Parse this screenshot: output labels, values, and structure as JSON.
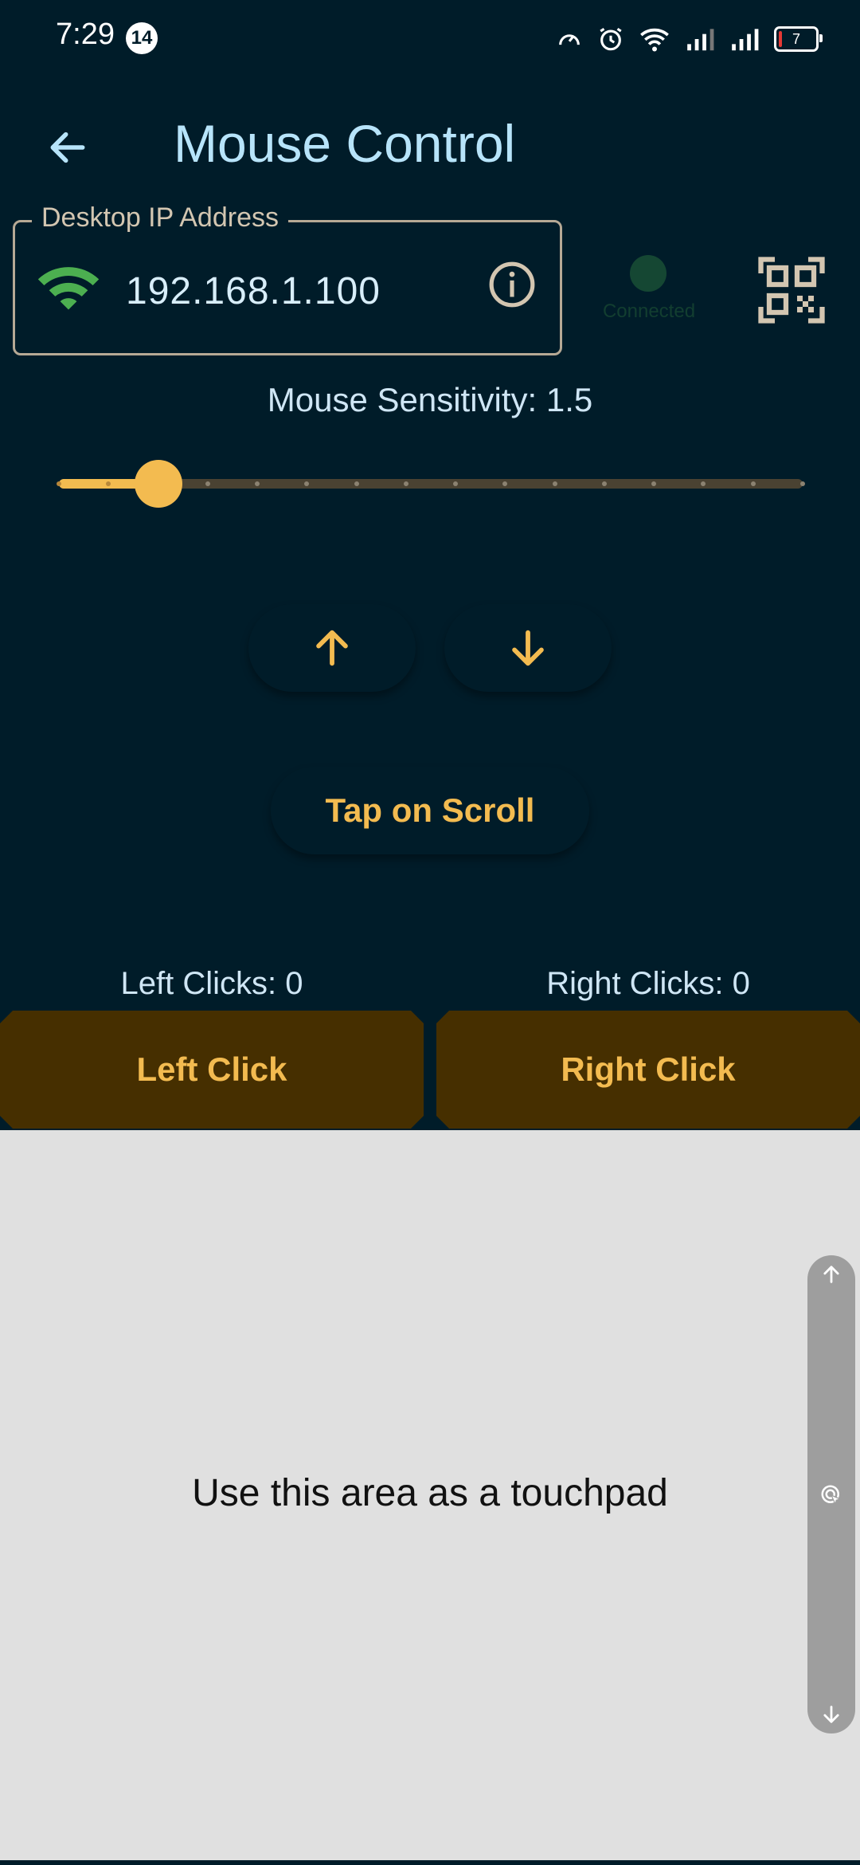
{
  "status_bar": {
    "time": "7:29",
    "notification_count": "14",
    "battery_level": "7",
    "icons": [
      "speedometer-icon",
      "alarm-icon",
      "wifi-icon",
      "signal-icon",
      "signal-icon",
      "battery-icon"
    ]
  },
  "app_bar": {
    "title": "Mouse Control",
    "back_icon": "arrow-left-icon"
  },
  "ip_field": {
    "label": "Desktop IP Address",
    "value": "192.168.1.100",
    "leading_icon": "wifi-icon",
    "trailing_icon": "info-icon"
  },
  "connection": {
    "status_text": "Connected",
    "indicator_color": "#154733"
  },
  "qr_button": {
    "icon": "qr-code-icon"
  },
  "sensitivity": {
    "label": "Mouse Sensitivity: 1.5",
    "value": 1.5,
    "min": 0.5,
    "max": 8.0,
    "divisions": 15
  },
  "scroll_controls": {
    "up_icon": "arrow-up-icon",
    "down_icon": "arrow-down-icon",
    "tap_on_scroll_label": "Tap on Scroll"
  },
  "clicks": {
    "left_count_label": "Left Clicks: 0",
    "right_count_label": "Right Clicks: 0",
    "left_button_label": "Left Click",
    "right_button_label": "Right Click"
  },
  "touchpad": {
    "hint": "Use this area as a touchpad",
    "scrollbar_icons": [
      "arrow-up-icon",
      "touch-icon",
      "arrow-down-icon"
    ]
  },
  "colors": {
    "background": "#001c29",
    "accent": "#f3bb50",
    "button_bg": "#462f00",
    "touchpad_bg": "#e0e0e0",
    "wifi_green": "#4caf50"
  }
}
